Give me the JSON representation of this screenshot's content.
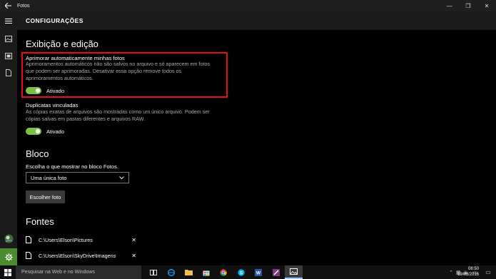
{
  "window": {
    "title": "Fotos",
    "controls": {
      "minimize": "—",
      "maximize": "❐",
      "close": "✕"
    }
  },
  "header": {
    "title": "CONFIGURAÇÕES"
  },
  "sidebar": {
    "icons": [
      "menu-icon",
      "collection-icon",
      "albums-icon",
      "folders-icon",
      "avatar-icon",
      "settings-icon"
    ]
  },
  "sections": {
    "display": {
      "heading": "Exibição e edição",
      "enhance": {
        "title": "Aprimorar automaticamente minhas fotos",
        "description_lines": [
          "Aprimoramentos automáticos não são salvos no arquivo e só aparecem em fotos",
          "que podem ser aprimoradas. Desativar essa opção remove todos os",
          "aprimoramentos automáticos."
        ],
        "toggle_on": true,
        "toggle_label": "Ativado"
      },
      "duplicates": {
        "title": "Duplicatas vinculadas",
        "description_lines": [
          "As cópias exatas de arquivos são mostradas como um único arquivo. Podem ser",
          "cópias salvas em pastas diferentes e arquivos RAW."
        ],
        "toggle_on": true,
        "toggle_label": "Ativado"
      }
    },
    "tile": {
      "heading": "Bloco",
      "label": "Escolha o que mostrar no bloco Fotos.",
      "selected": "Uma única foto",
      "button": "Escolher foto"
    },
    "sources": {
      "heading": "Fontes",
      "folders": [
        "C:\\Users\\Elson\\Pictures",
        "C:\\Users\\Elson\\SkyDrive\\Imagens"
      ],
      "remove_glyph": "✕"
    }
  },
  "taskbar": {
    "search_placeholder": "Pesquisar na Web e no Windows",
    "apps": [
      "task-view-icon",
      "edge-icon",
      "file-explorer-icon",
      "store-icon",
      "chrome-icon",
      "skype-icon",
      "word-icon",
      "onenote-icon",
      "photos-icon"
    ],
    "active_app": "photos-icon",
    "time": "08:50",
    "date": "19/01/2016"
  },
  "colors": {
    "accent_green": "#7ac043",
    "settings_rail": "#4c8b2f",
    "highlight_border": "#e3101c"
  }
}
